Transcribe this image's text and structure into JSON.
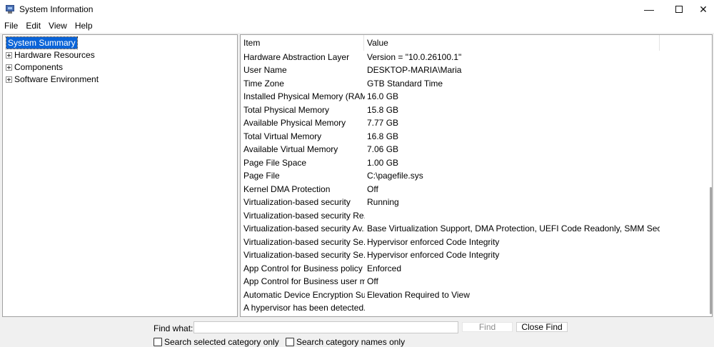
{
  "window": {
    "title": "System Information",
    "minimize_glyph": "—",
    "close_glyph": "✕"
  },
  "menu": [
    "File",
    "Edit",
    "View",
    "Help"
  ],
  "tree": {
    "selected": "System Summary",
    "items": [
      "Hardware Resources",
      "Components",
      "Software Environment"
    ]
  },
  "table": {
    "columns": [
      "Item",
      "Value"
    ],
    "rows": [
      {
        "item": "Hardware Abstraction Layer",
        "value": "Version = \"10.0.26100.1\""
      },
      {
        "item": "User Name",
        "value": "DESKTOP-MARIA\\Maria"
      },
      {
        "item": "Time Zone",
        "value": "GTB Standard Time"
      },
      {
        "item": "Installed Physical Memory (RAM)",
        "value": "16.0 GB"
      },
      {
        "item": "Total Physical Memory",
        "value": "15.8 GB"
      },
      {
        "item": "Available Physical Memory",
        "value": "7.77 GB"
      },
      {
        "item": "Total Virtual Memory",
        "value": "16.8 GB"
      },
      {
        "item": "Available Virtual Memory",
        "value": "7.06 GB"
      },
      {
        "item": "Page File Space",
        "value": "1.00 GB"
      },
      {
        "item": "Page File",
        "value": "C:\\pagefile.sys"
      },
      {
        "item": "Kernel DMA Protection",
        "value": "Off"
      },
      {
        "item": "Virtualization-based security",
        "value": "Running"
      },
      {
        "item": "Virtualization-based security Re...",
        "value": ""
      },
      {
        "item": "Virtualization-based security Av...",
        "value": "Base Virtualization Support, DMA Protection, UEFI Code Readonly, SMM Securi..."
      },
      {
        "item": "Virtualization-based security Se...",
        "value": "Hypervisor enforced Code Integrity"
      },
      {
        "item": "Virtualization-based security Se...",
        "value": "Hypervisor enforced Code Integrity"
      },
      {
        "item": "App Control for Business policy",
        "value": "Enforced"
      },
      {
        "item": "App Control for Business user m...",
        "value": "Off"
      },
      {
        "item": "Automatic Device Encryption Su...",
        "value": "Elevation Required to View"
      },
      {
        "item": "A hypervisor has been detected....",
        "value": ""
      }
    ]
  },
  "find": {
    "label": "Find what:",
    "value": "",
    "find_button": "Find",
    "close_find_button": "Close Find",
    "search_selected_label": "Search selected category only",
    "search_names_label": "Search category names only"
  }
}
